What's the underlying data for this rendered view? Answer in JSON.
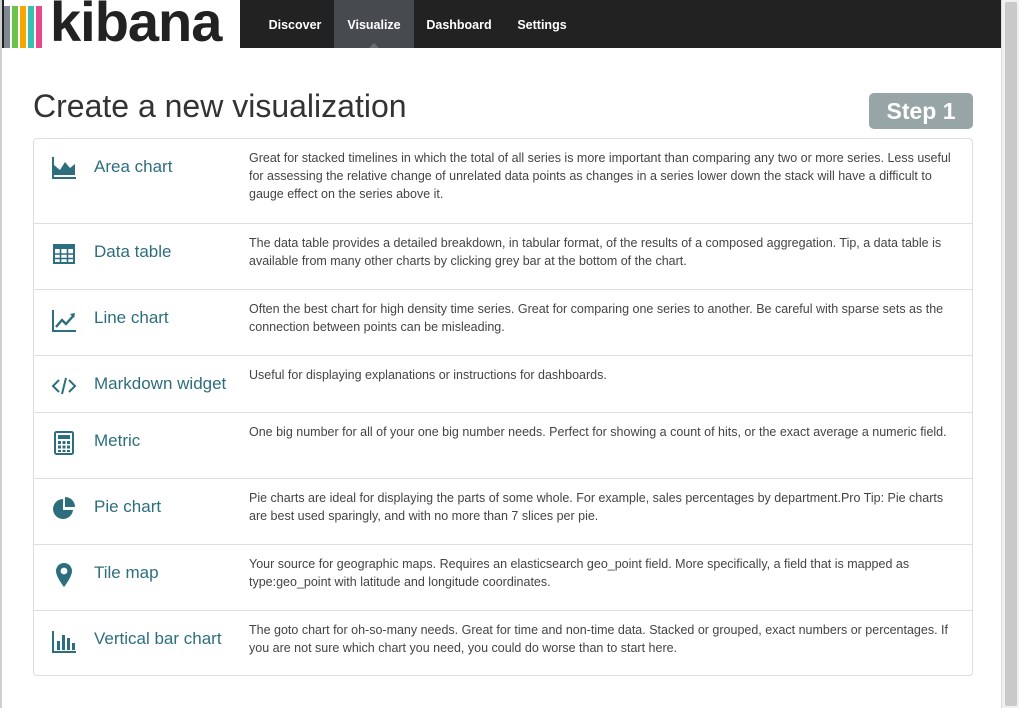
{
  "navbar": {
    "logo_text": "kibana",
    "brand_colors": [
      "#e8488b",
      "#f5a700",
      "#3cbfae",
      "#6dc24b",
      "#7e8a92"
    ],
    "items": [
      {
        "label": "Discover",
        "active": false
      },
      {
        "label": "Visualize",
        "active": true
      },
      {
        "label": "Dashboard",
        "active": false
      },
      {
        "label": "Settings",
        "active": false
      }
    ]
  },
  "page": {
    "title": "Create a new visualization",
    "step_label": "Step 1"
  },
  "visualizations": [
    {
      "icon": "area-chart-icon",
      "title": "Area chart",
      "description": "Great for stacked timelines in which the total of all series is more important than comparing any two or more series. Less useful for assessing the relative change of unrelated data points as changes in a series lower down the stack will have a difficult to gauge effect on the series above it."
    },
    {
      "icon": "table-icon",
      "title": "Data table",
      "description": "The data table provides a detailed breakdown, in tabular format, of the results of a composed aggregation. Tip, a data table is available from many other charts by clicking grey bar at the bottom of the chart."
    },
    {
      "icon": "line-chart-icon",
      "title": "Line chart",
      "description": "Often the best chart for high density time series. Great for comparing one series to another. Be careful with sparse sets as the connection between points can be misleading."
    },
    {
      "icon": "code-icon",
      "title": "Markdown widget",
      "description": "Useful for displaying explanations or instructions for dashboards."
    },
    {
      "icon": "calculator-icon",
      "title": "Metric",
      "description": "One big number for all of your one big number needs. Perfect for showing a count of hits, or the exact average a numeric field."
    },
    {
      "icon": "pie-chart-icon",
      "title": "Pie chart",
      "description": "Pie charts are ideal for displaying the parts of some whole. For example, sales percentages by department.Pro Tip: Pie charts are best used sparingly, and with no more than 7 slices per pie."
    },
    {
      "icon": "map-marker-icon",
      "title": "Tile map",
      "description": "Your source for geographic maps. Requires an elasticsearch geo_point field. More specifically, a field that is mapped as type:geo_point with latitude and longitude coordinates."
    },
    {
      "icon": "bar-chart-icon",
      "title": "Vertical bar chart",
      "description": "The goto chart for oh-so-many needs. Great for time and non-time data. Stacked or grouped, exact numbers or percentages. If you are not sure which chart you need, you could do worse than to start here."
    }
  ],
  "theme": {
    "accent": "#2d6e7e",
    "navbar_bg": "#222222",
    "active_tab_bg": "#474b50",
    "step_badge_bg": "#98a5a6"
  }
}
